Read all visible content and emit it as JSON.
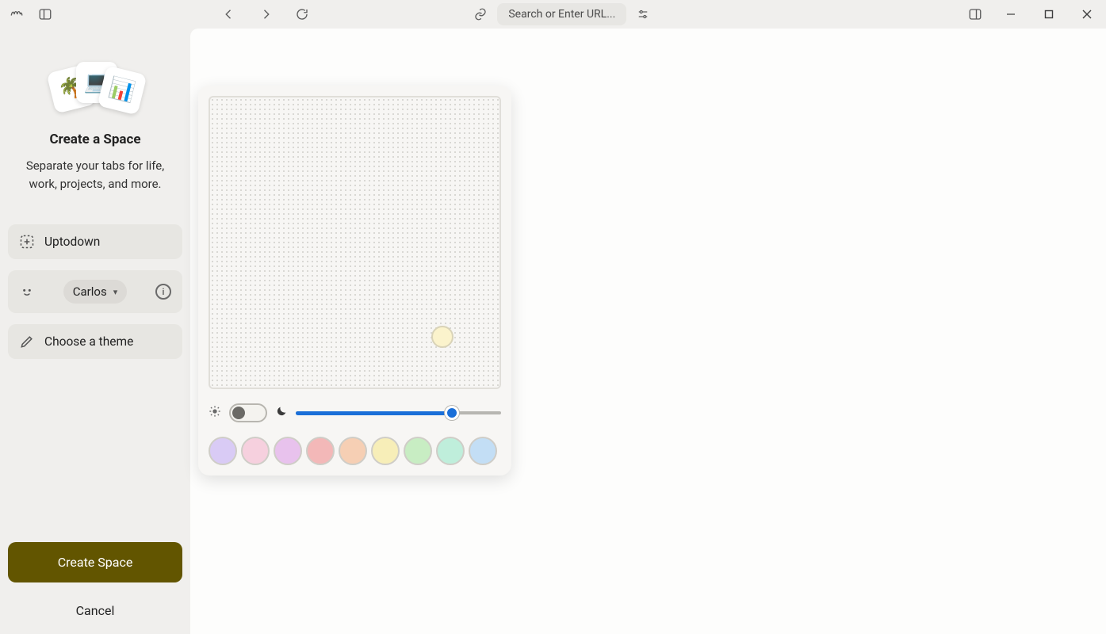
{
  "titlebar": {
    "search_placeholder": "Search or Enter URL..."
  },
  "sidebar": {
    "title": "Create a Space",
    "subtitle": "Separate your tabs for life, work, projects, and more.",
    "card_emojis": [
      "🌴",
      "💻",
      "📊"
    ],
    "options": {
      "space_name": "Uptodown",
      "profile_name": "Carlos",
      "theme_label": "Choose a theme"
    },
    "buttons": {
      "primary": "Create Space",
      "cancel": "Cancel"
    }
  },
  "theme_panel": {
    "dark_mode_on": false,
    "intensity_percent": 76,
    "swatches": [
      "#d9cbf5",
      "#f6d0de",
      "#e8c2ed",
      "#f3b8b8",
      "#f6cfb4",
      "#f7eeb8",
      "#c8edc3",
      "#bfeedb",
      "#c3def5"
    ]
  }
}
